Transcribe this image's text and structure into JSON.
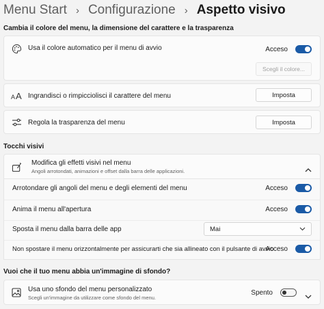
{
  "breadcrumb": {
    "items": [
      "Menu Start",
      "Configurazione"
    ],
    "separator": "›",
    "current": "Aspetto visivo"
  },
  "sections": {
    "colors_title": "Cambia il colore del menu, la dimensione del carattere e la trasparenza",
    "visual_title": "Tocchi visivi",
    "background_title": "Vuoi che il tuo menu abbia un'immagine di sfondo?"
  },
  "auto_color": {
    "label": "Usa il colore automatico per il menu di avvio",
    "state": "Acceso",
    "on": true,
    "pick_button": "Scegli il colore..."
  },
  "font_size": {
    "label": "Ingrandisci o rimpicciolisci il carattere del menu",
    "button": "Imposta"
  },
  "transparency": {
    "label": "Regola la trasparenza del menu",
    "button": "Imposta"
  },
  "visual_effects": {
    "label": "Modifica gli effetti visivi nel menu",
    "sublabel": "Angoli arrotondati, animazioni e offset dalla barra delle applicazioni.",
    "rows": [
      {
        "label": "Arrotondare gli angoli del menu e degli elementi del menu",
        "state": "Acceso",
        "on": true
      },
      {
        "label": "Anima il menu all'apertura",
        "state": "Acceso",
        "on": true
      }
    ],
    "offset": {
      "label": "Sposta il menu dalla barra delle app",
      "value": "Mai"
    },
    "no_horizontal": {
      "label": "Non spostare il menu orizzontalmente per assicurarti che sia allineato con il pulsante di avvio",
      "state": "Acceso",
      "on": true
    }
  },
  "custom_background": {
    "label": "Usa uno sfondo del menu personalizzato",
    "sublabel": "Scegli un'immagine da utilizzare come sfondo del menu.",
    "state": "Spento",
    "on": false
  },
  "colors": {
    "accent": "#1a5aa6",
    "background": "#f3f3f3",
    "card": "#fbfbfb"
  }
}
